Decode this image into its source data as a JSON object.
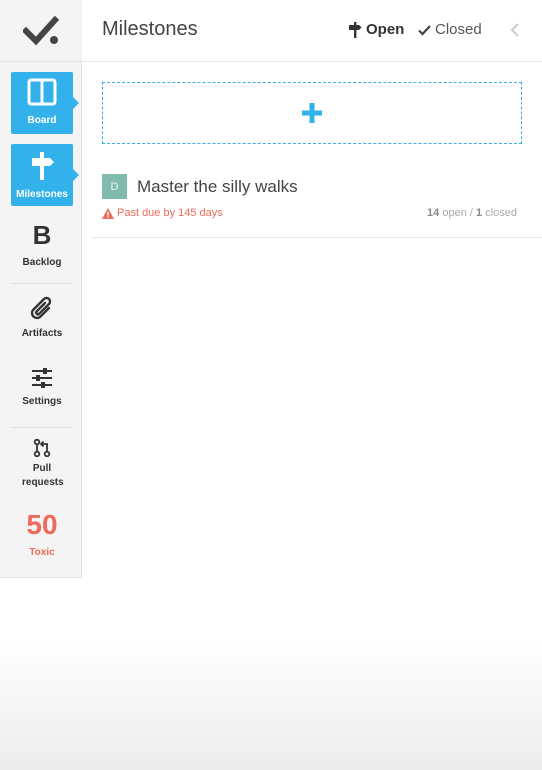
{
  "sidebar": {
    "items": [
      {
        "name": "board",
        "label": "Board",
        "icon": "board-icon",
        "active": true
      },
      {
        "name": "milestones",
        "label": "Milestones",
        "icon": "signpost-icon",
        "active": true
      },
      {
        "name": "backlog",
        "label": "Backlog",
        "icon": "bold-b-icon",
        "glyph": "B"
      },
      {
        "name": "artifacts",
        "label": "Artifacts",
        "icon": "paperclip-icon"
      },
      {
        "name": "settings",
        "label": "Settings",
        "icon": "sliders-icon"
      },
      {
        "name": "pull-requests",
        "label": "Pull requests",
        "icon": "pull-request-icon"
      },
      {
        "name": "toxic",
        "label": "Toxic",
        "count": "50"
      }
    ]
  },
  "header": {
    "title": "Milestones",
    "open_label": "Open",
    "closed_label": "Closed"
  },
  "milestones": [
    {
      "avatar": "D",
      "title": "Master the silly walks",
      "due": "Past due by 145 days",
      "open_count": "14",
      "open_label": "open /",
      "closed_count": "1",
      "closed_label": "closed"
    }
  ],
  "colors": {
    "accent": "#33b1ea",
    "danger": "#ee6a5a",
    "avatar": "#7fbcad"
  }
}
